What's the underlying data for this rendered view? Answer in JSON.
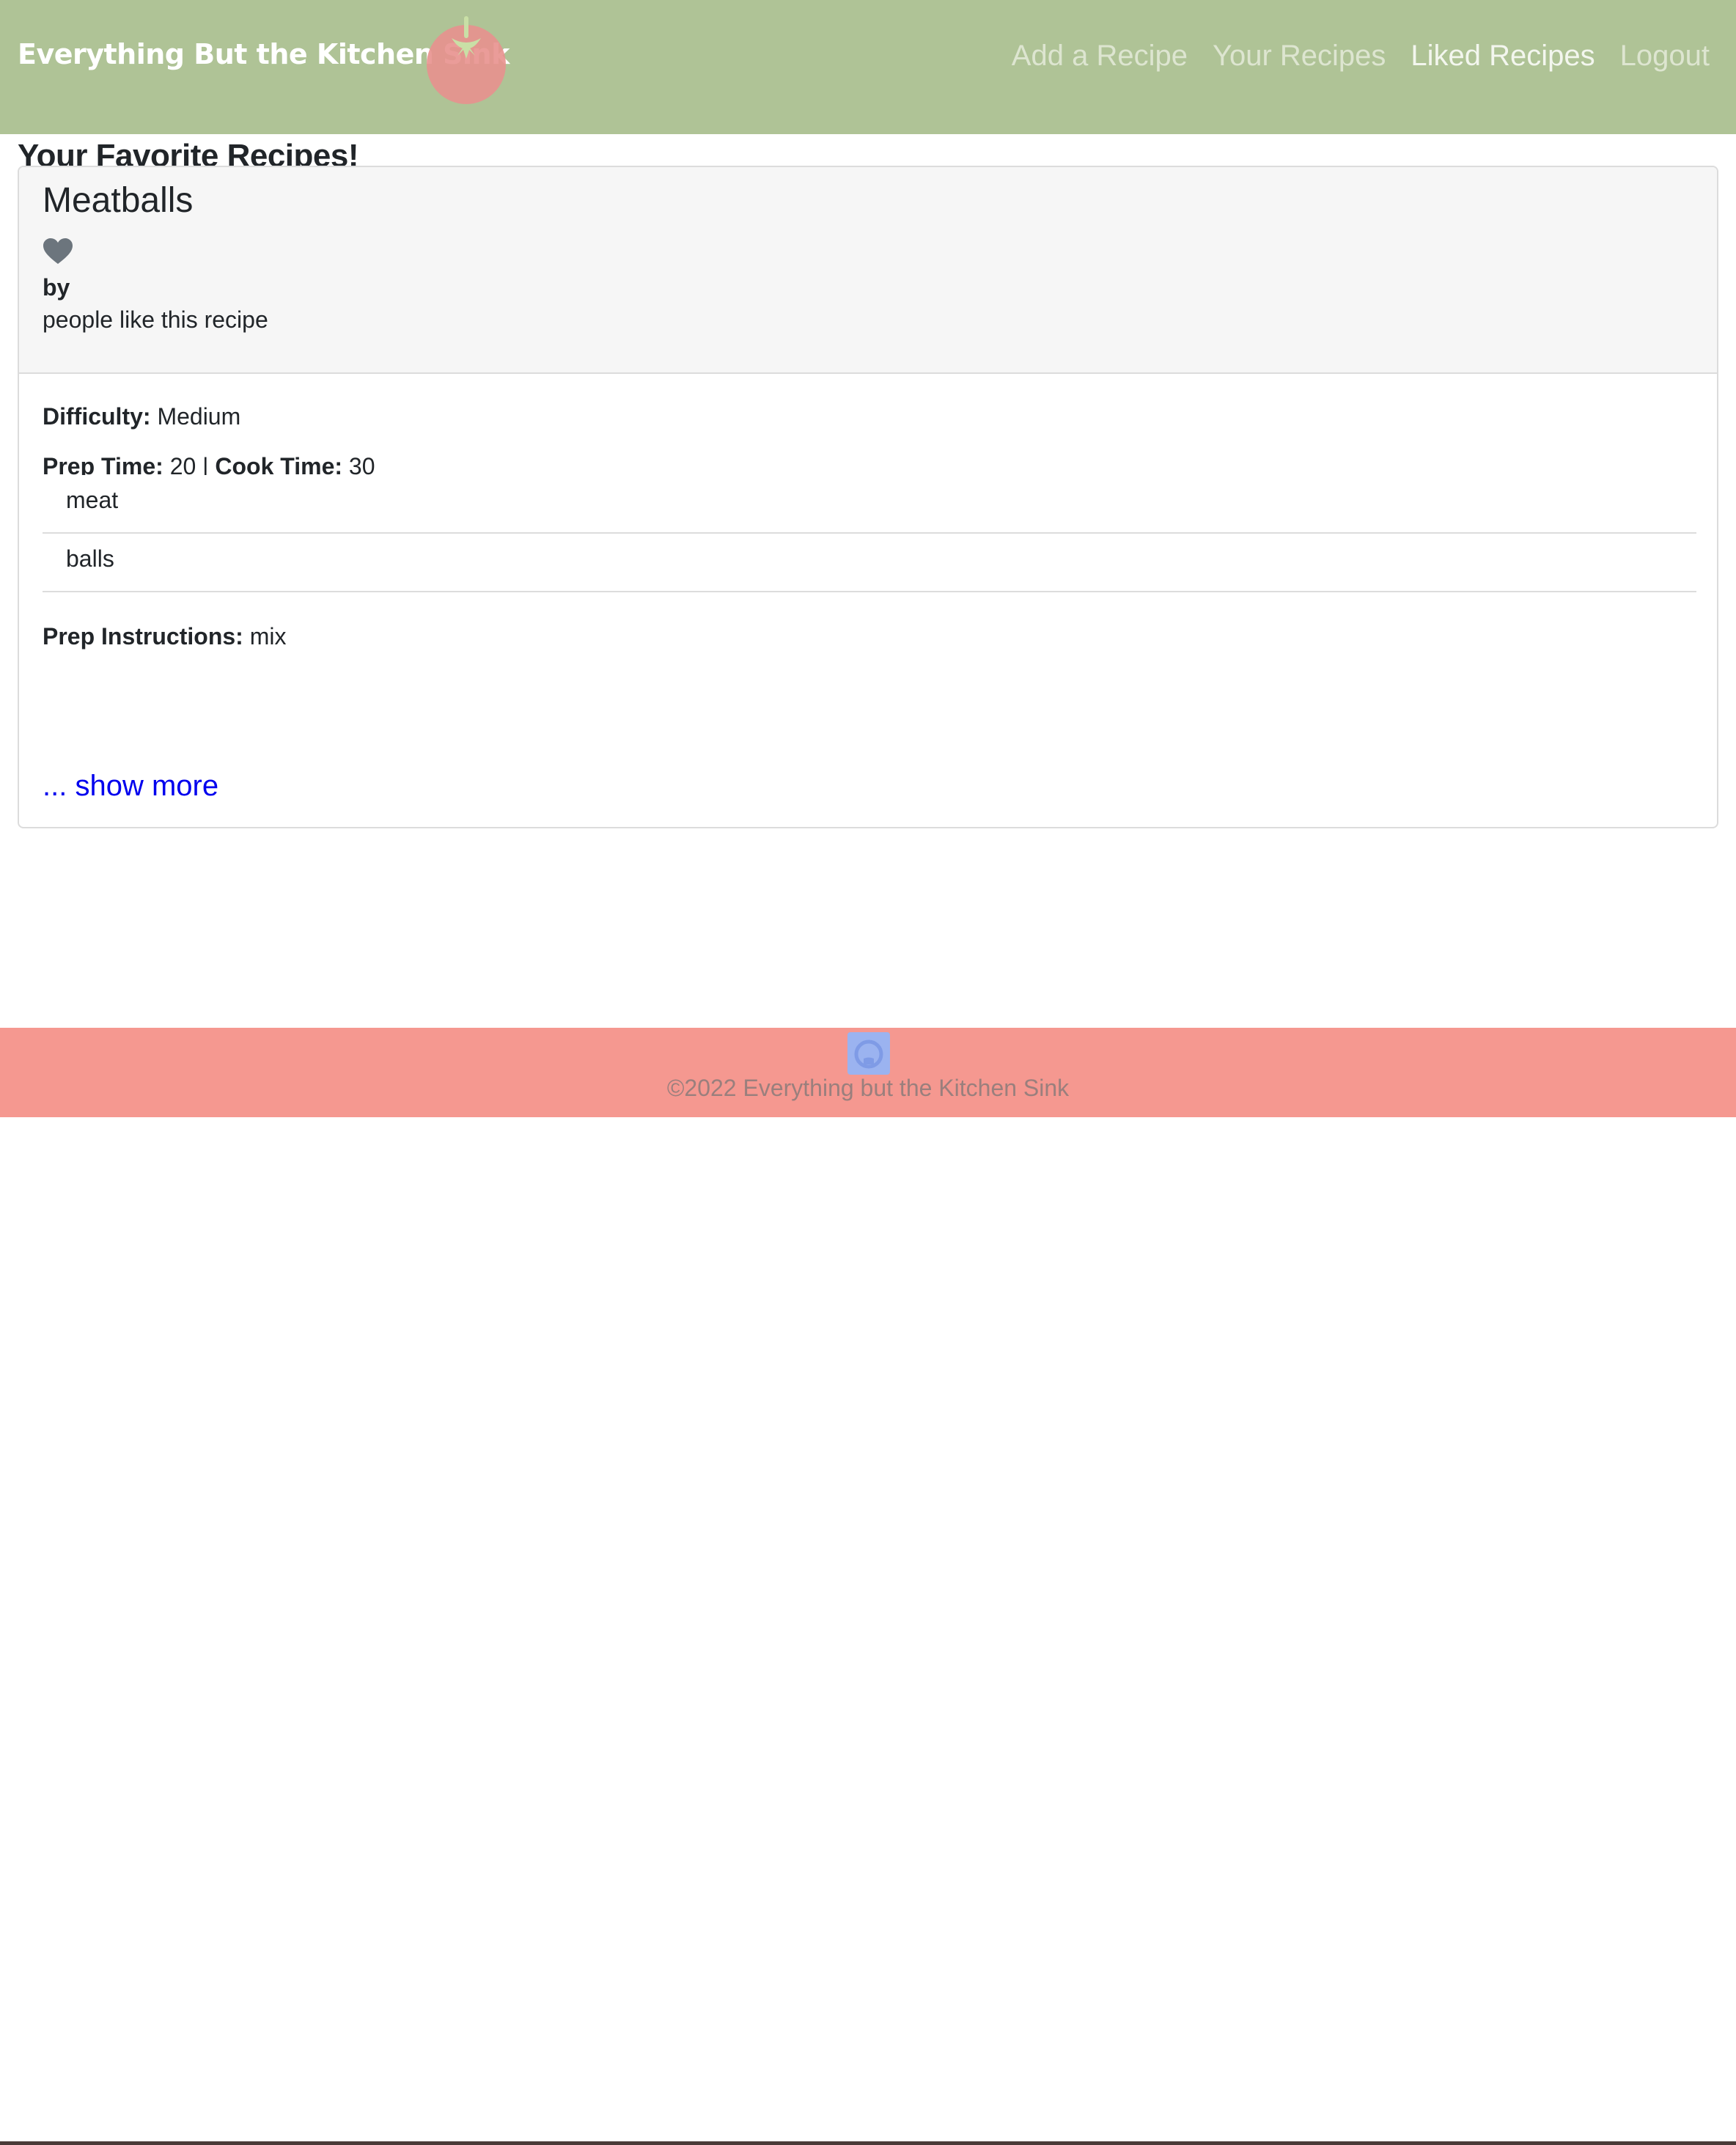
{
  "header": {
    "brand": "Everything But the Kitchen Sink",
    "logo_icon": "tomato-icon",
    "nav": [
      {
        "label": "Add a Recipe",
        "active": false
      },
      {
        "label": "Your Recipes",
        "active": false
      },
      {
        "label": "Liked Recipes",
        "active": true
      },
      {
        "label": "Logout",
        "active": false
      }
    ]
  },
  "main": {
    "page_title": "Your Favorite Recipes!",
    "recipe": {
      "title": "Meatballs",
      "like_icon": "heart-icon",
      "author_label": "by",
      "likes_text": "people like this recipe",
      "difficulty_label": "Difficulty:",
      "difficulty_value": "Medium",
      "prep_time_label": "Prep Time:",
      "prep_time_value": "20",
      "separator": "|",
      "cook_time_label": "Cook Time:",
      "cook_time_value": "30",
      "ingredients": [
        "meat",
        "balls"
      ],
      "instructions_label": "Prep Instructions:",
      "instructions_value": "mix",
      "show_more": "... show more"
    }
  },
  "footer": {
    "icon": "github-icon",
    "copyright": "©2022 Everything but the Kitchen Sink"
  },
  "colors": {
    "navbar": "#afc396",
    "footer": "#f59890",
    "link": "#0000ee"
  }
}
